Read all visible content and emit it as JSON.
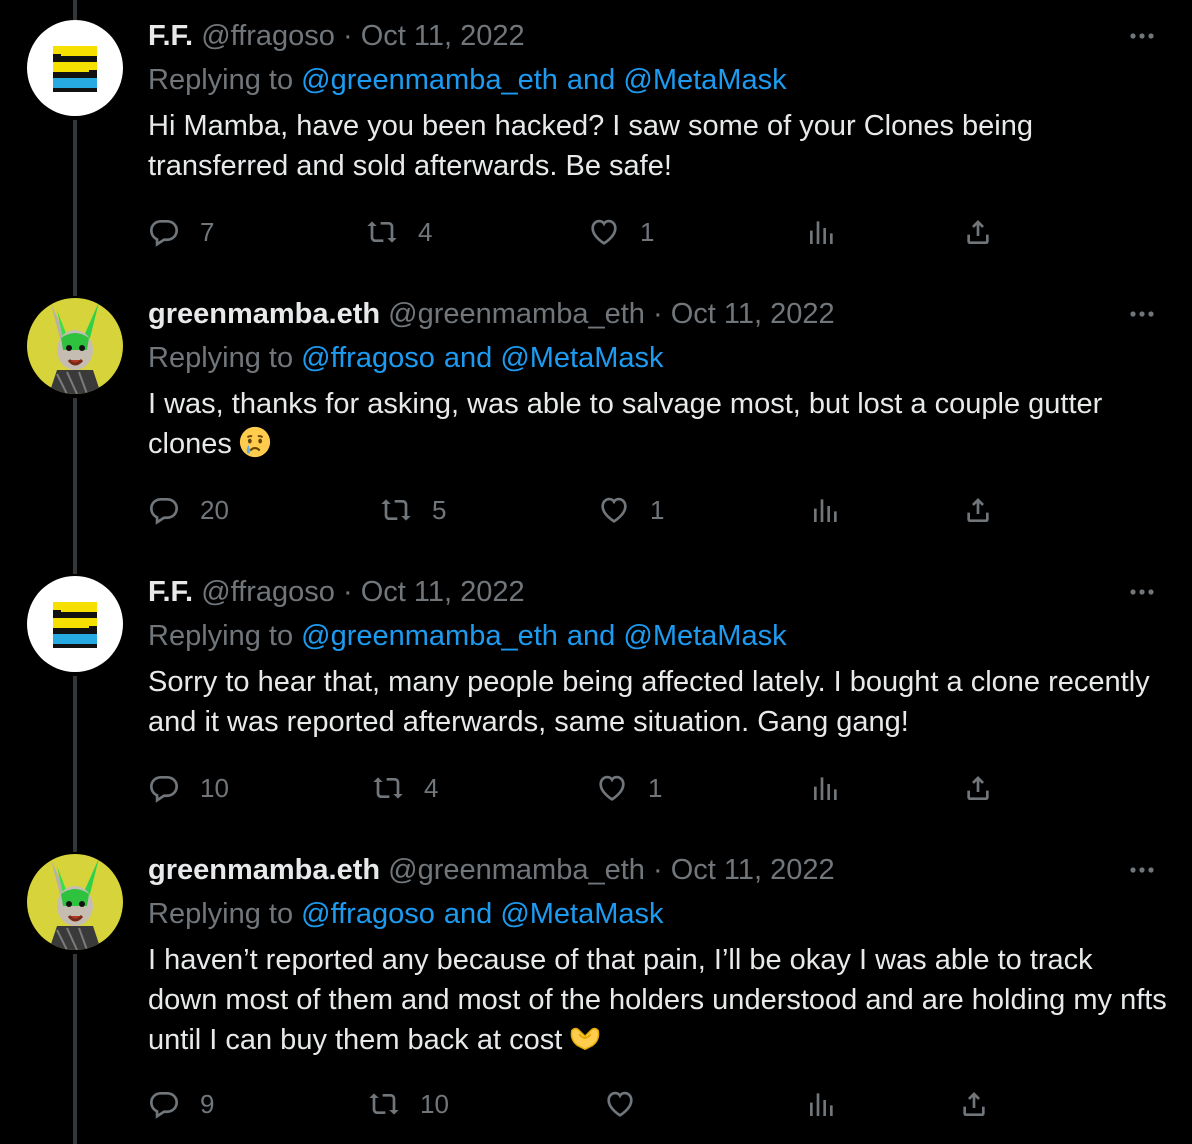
{
  "colors": {
    "background": "#000000",
    "text": "#e7e9ea",
    "muted": "#71767b",
    "link": "#1d9bf0",
    "thread_line": "#333639"
  },
  "labels": {
    "replying_to": "Replying to",
    "and": "and"
  },
  "tweets": [
    {
      "avatar": "ff-stripes-avatar",
      "name": "F.F.",
      "handle": "@ffragoso",
      "separator": "·",
      "date": "Oct 11, 2022",
      "mentions": [
        "@greenmamba_eth",
        "@MetaMask"
      ],
      "text": "Hi Mamba, have you been hacked? I saw some of your Clones being transferred and sold afterwards. Be safe!",
      "emoji": "",
      "replies": "7",
      "retweets": "4",
      "likes": "1"
    },
    {
      "avatar": "green-rabbit-avatar",
      "name": "greenmamba.eth",
      "handle": "@greenmamba_eth",
      "separator": "·",
      "date": "Oct 11, 2022",
      "mentions": [
        "@ffragoso",
        "@MetaMask"
      ],
      "text": "I was, thanks for asking, was able to salvage most, but lost a couple gutter clones",
      "emoji": "crying-face",
      "replies": "20",
      "retweets": "5",
      "likes": "1"
    },
    {
      "avatar": "ff-stripes-avatar",
      "name": "F.F.",
      "handle": "@ffragoso",
      "separator": "·",
      "date": "Oct 11, 2022",
      "mentions": [
        "@greenmamba_eth",
        "@MetaMask"
      ],
      "text": "Sorry to hear that, many people being affected lately. I bought a clone recently and it was reported afterwards, same situation. Gang gang!",
      "emoji": "",
      "replies": "10",
      "retweets": "4",
      "likes": "1"
    },
    {
      "avatar": "green-rabbit-avatar",
      "name": "greenmamba.eth",
      "handle": "@greenmamba_eth",
      "separator": "·",
      "date": "Oct 11, 2022",
      "mentions": [
        "@ffragoso",
        "@MetaMask"
      ],
      "text": "I haven’t reported any because of that pain, I’ll be okay I was able to track down most of them and most of the holders understood and are holding my nfts until I can buy them back at cost",
      "emoji": "heart-hands",
      "replies": "9",
      "retweets": "10",
      "likes": ""
    }
  ]
}
